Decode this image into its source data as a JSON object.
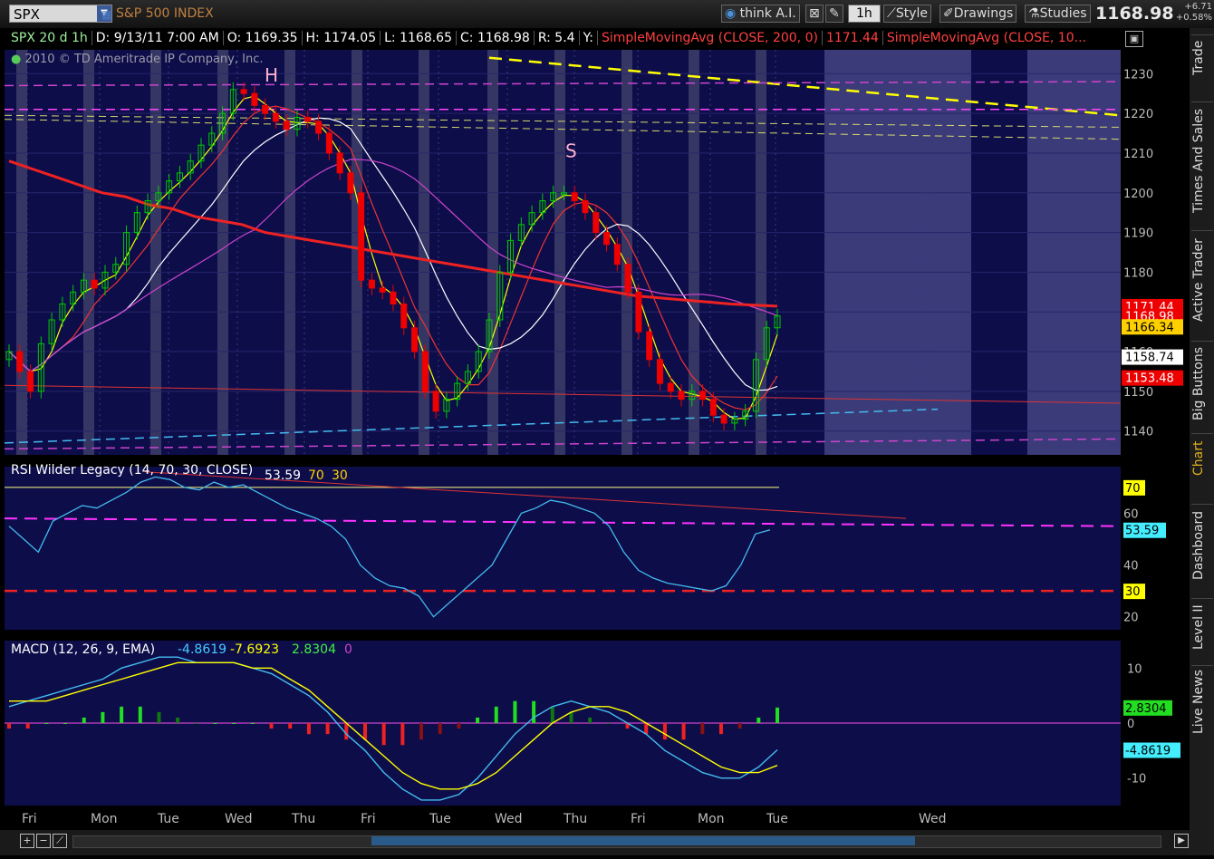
{
  "toolbar": {
    "symbol": "SPX",
    "description": "S&P 500 INDEX",
    "think_label": "think A.I.",
    "timeframe": "1h",
    "style_label": "Style",
    "drawings_label": "Drawings",
    "studies_label": "Studies",
    "last_price": "1168.98",
    "change_pts": "+6.71",
    "change_pct": "+0.58%"
  },
  "infobar": {
    "chart_id": "SPX 20 d 1h",
    "date": "D: 9/13/11 7:00 AM",
    "open": "O: 1169.35",
    "high": "H: 1174.05",
    "low": "L: 1168.65",
    "close": "C: 1168.98",
    "range": "R: 5.4",
    "y_label": "Y:",
    "sma200_label": "SimpleMovingAvg (CLOSE, 200, 0)",
    "sma200_value": "1171.44",
    "sma_other_label": "SimpleMovingAvg (CLOSE, 10..."
  },
  "copyright": "2010 © TD Ameritrade IP Company, Inc.",
  "sidebar_tabs": [
    "Trade",
    "Times And Sales",
    "Active Trader",
    "Big Buttons",
    "Chart",
    "Dashboard",
    "Level II",
    "Live News"
  ],
  "annotations": {
    "head": "H",
    "shoulder": "S"
  },
  "colors": {
    "panel_bg": "#0d0d4a",
    "up": "#00cc00",
    "down": "#ee0000",
    "sma200": "#ee2222",
    "ema_yellow": "#ffff00",
    "white_ma": "#ffffff",
    "magenta": "#cc44cc",
    "cyan": "#44bbee"
  },
  "chart_data": [
    {
      "type": "candlestick",
      "title": "SPX 20 d 1h",
      "ylim": [
        1134,
        1236
      ],
      "y_ticks": [
        1140,
        1150,
        1160,
        1170,
        1180,
        1190,
        1200,
        1210,
        1220,
        1230
      ],
      "x_day_labels": [
        "Fri",
        "Mon",
        "Tue",
        "Wed",
        "Thu",
        "Fri",
        "Tue",
        "Wed",
        "Thu",
        "Fri",
        "Mon",
        "Tue",
        "Wed"
      ],
      "price_labels": [
        {
          "value": "1171.44",
          "color": "#ee0000"
        },
        {
          "value": "1168.98",
          "color": "#ee0000"
        },
        {
          "value": "1166.34",
          "color": "#ffd000"
        },
        {
          "value": "1158.74",
          "color": "#ffffff"
        },
        {
          "value": "1153.48",
          "color": "#ee0000"
        }
      ],
      "closes": [
        1160,
        1155,
        1150,
        1162,
        1168,
        1172,
        1175,
        1178,
        1176,
        1180,
        1182,
        1190,
        1195,
        1198,
        1200,
        1203,
        1205,
        1208,
        1212,
        1215,
        1220,
        1226,
        1225,
        1222,
        1220,
        1218,
        1216,
        1219,
        1218,
        1215,
        1210,
        1205,
        1200,
        1178,
        1176,
        1175,
        1172,
        1166,
        1160,
        1150,
        1145,
        1148,
        1152,
        1155,
        1160,
        1168,
        1180,
        1188,
        1192,
        1195,
        1198,
        1200,
        1200,
        1198,
        1195,
        1190,
        1187,
        1182,
        1175,
        1165,
        1158,
        1152,
        1150,
        1148,
        1150,
        1148,
        1144,
        1142,
        1143,
        1145,
        1158,
        1166,
        1168.98
      ],
      "series": [
        {
          "name": "SimpleMovingAvg (CLOSE, 200, 0)",
          "values": [
            1208,
            1206,
            1204,
            1202,
            1200,
            1199,
            1197,
            1196,
            1194,
            1193,
            1192,
            1190,
            1189,
            1188,
            1187,
            1186,
            1185,
            1184,
            1183,
            1182,
            1181,
            1180,
            1179,
            1178,
            1177,
            1176,
            1175,
            1174,
            1173.5,
            1173,
            1172.5,
            1172,
            1171.7,
            1171.44
          ]
        }
      ],
      "annotations": [
        "H",
        "S"
      ]
    },
    {
      "type": "line",
      "title": "RSI Wilder Legacy (14, 70, 30, CLOSE)",
      "header_values": [
        "53.59",
        "70",
        "30"
      ],
      "ylim": [
        15,
        78
      ],
      "y_ticks": [
        20,
        30,
        40,
        50,
        60,
        70
      ],
      "overbought": 70,
      "oversold": 30,
      "last_value": 53.59,
      "values": [
        55,
        50,
        45,
        57,
        60,
        63,
        62,
        65,
        68,
        72,
        74,
        73,
        70,
        69,
        72,
        70,
        71,
        68,
        65,
        62,
        60,
        58,
        55,
        50,
        40,
        35,
        32,
        31,
        28,
        20,
        25,
        30,
        35,
        40,
        50,
        60,
        62,
        65,
        64,
        62,
        60,
        55,
        45,
        38,
        35,
        33,
        32,
        31,
        30,
        32,
        40,
        52,
        53.59
      ]
    },
    {
      "type": "bar",
      "title": "MACD (12, 26, 9, EMA)",
      "header_values": [
        "-4.8619",
        "-7.6923",
        "2.8304",
        "0"
      ],
      "ylim": [
        -15,
        15
      ],
      "y_ticks": [
        -10,
        0,
        10
      ],
      "diff_last": 2.8304,
      "value_last": -4.8619,
      "macd": [
        3,
        4,
        5,
        6,
        7,
        8,
        10,
        11,
        12,
        12,
        11,
        11,
        11,
        10,
        9,
        7,
        5,
        2,
        -2,
        -5,
        -9,
        -12,
        -14,
        -14,
        -13,
        -10,
        -6,
        -2,
        1,
        3,
        4,
        3,
        2,
        0,
        -2,
        -5,
        -7,
        -9,
        -10,
        -10,
        -8,
        -4.8619
      ],
      "avg": [
        4,
        4,
        4,
        5,
        6,
        7,
        8,
        9,
        10,
        11,
        11,
        11,
        11,
        10,
        10,
        8,
        6,
        3,
        0,
        -3,
        -6,
        -9,
        -11,
        -12,
        -12,
        -11,
        -9,
        -6,
        -3,
        0,
        2,
        3,
        3,
        2,
        0,
        -2,
        -4,
        -6,
        -8,
        -9,
        -9,
        -7.6923
      ],
      "diff": [
        -1,
        -1,
        0,
        0,
        1,
        2,
        3,
        3,
        2,
        1,
        0,
        0,
        0,
        0,
        -1,
        -1,
        -2,
        -2,
        -3,
        -3,
        -4,
        -4,
        -3,
        -2,
        -1,
        1,
        3,
        4,
        4,
        3,
        2,
        1,
        0,
        -1,
        -2,
        -3,
        -3,
        -2,
        -2,
        -1,
        1,
        2.8304
      ]
    }
  ]
}
